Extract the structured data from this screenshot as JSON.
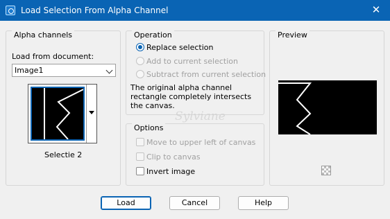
{
  "window": {
    "title": "Load Selection From Alpha Channel",
    "close_glyph": "✕"
  },
  "alpha": {
    "group_title": "Alpha channels",
    "load_from_label": "Load from document:",
    "document_value": "Image1",
    "channel_name": "Selectie 2"
  },
  "operation": {
    "group_title": "Operation",
    "replace": "Replace selection",
    "add": "Add to current selection",
    "subtract": "Subtract from current selection",
    "message": "The original alpha channel rectangle completely intersects the canvas."
  },
  "options": {
    "group_title": "Options",
    "move": "Move to upper left of canvas",
    "clip": "Clip to canvas",
    "invert": "Invert image"
  },
  "preview": {
    "group_title": "Preview"
  },
  "buttons": {
    "load": "Load",
    "cancel": "Cancel",
    "help": "Help"
  },
  "watermark": {
    "text": "Sylviane"
  },
  "colors": {
    "accent": "#0a64b4",
    "thumb_bg": "#000000",
    "thumb_line": "#ffffff"
  }
}
